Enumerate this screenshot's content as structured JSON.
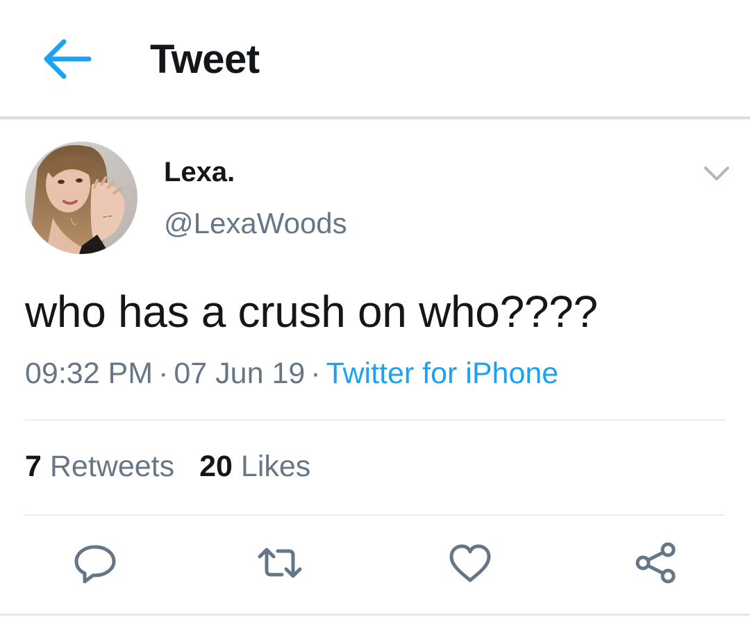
{
  "header": {
    "title": "Tweet",
    "back_icon": "arrow-left-icon"
  },
  "tweet": {
    "author": {
      "display_name": "Lexa.",
      "handle": "@LexaWoods"
    },
    "text": "who has a crush on who????",
    "time": "09:32 PM",
    "date": "07 Jun 19",
    "separator": "·",
    "source": "Twitter for iPhone",
    "stats": {
      "retweets_count": "7",
      "retweets_label": "Retweets",
      "likes_count": "20",
      "likes_label": "Likes"
    }
  },
  "actions": [
    {
      "name": "reply",
      "icon": "comment-bubble-icon"
    },
    {
      "name": "retweet",
      "icon": "retweet-arrows-icon"
    },
    {
      "name": "like",
      "icon": "heart-icon"
    },
    {
      "name": "share",
      "icon": "share-nodes-icon"
    }
  ],
  "colors": {
    "accent": "#1da1f2",
    "text_primary": "#14171a",
    "text_secondary": "#657786",
    "divider": "#e6ecf0",
    "icon_gray": "#657786"
  }
}
